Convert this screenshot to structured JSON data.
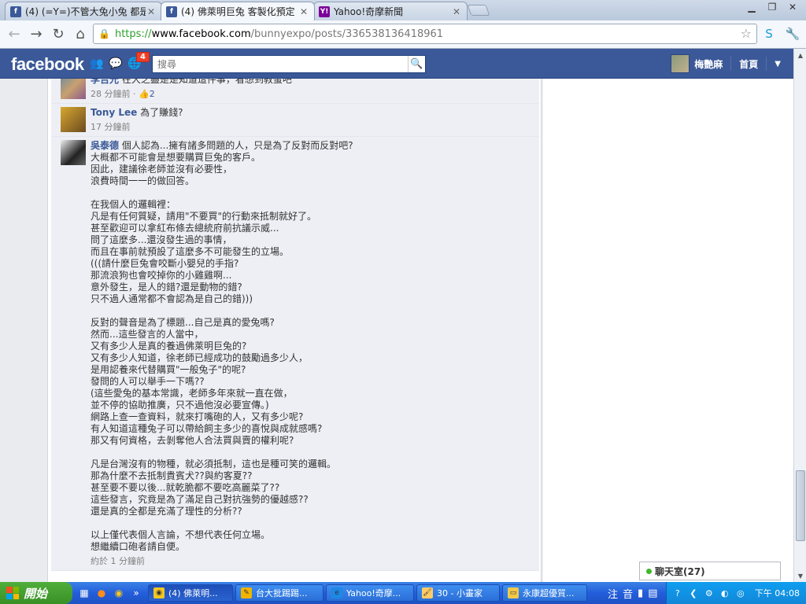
{
  "browser": {
    "tabs": [
      {
        "title": "(4) (=Y=)不管大兔小兔 都是",
        "active": false
      },
      {
        "title": "(4) 佛萊明巨兔 客製化預定",
        "active": true
      },
      {
        "title": "Yahoo!奇摩新聞",
        "active": false
      }
    ],
    "url": {
      "scheme": "https://",
      "host": "www.facebook.com",
      "path": "/bunnyexpo/posts/336538136418961"
    }
  },
  "facebook": {
    "logo": "facebook",
    "notification_count": "4",
    "search_placeholder": "搜尋",
    "user_name": "梅艷麻",
    "home_label": "首頁"
  },
  "comments": [
    {
      "name": "李吉光",
      "text_lines": [
        "在大之盡是是知道這件事，看想到教蛋吧"
      ],
      "time": "28 分鐘前",
      "likes": "2"
    },
    {
      "name": "Tony Lee",
      "text_lines": [
        "為了賺錢?"
      ],
      "time": "17 分鐘前",
      "likes": ""
    },
    {
      "name": "吳泰德",
      "text_lines": [
        "個人認為...擁有諸多問題的人，只是為了反對而反對吧?",
        "大概都不可能會是想要購買巨兔的客戶。",
        "因此，建議徐老師並沒有必要性，",
        "浪費時間一一的做回答。",
        "",
        "在我個人的邏輯裡：",
        "凡是有任何質疑，請用\"不要買\"的行動來抵制就好了。",
        "甚至歡迎可以拿紅布條去總統府前抗議示威...",
        "問了這麼多...還沒發生過的事情，",
        "而且在事前就預設了這麼多不可能發生的立場。",
        "(((請什麼巨兔會咬斷小嬰兒的手指?",
        "那流浪狗也會咬掉你的小雞雞啊...",
        "意外發生，是人的錯?還是動物的錯?",
        "只不過人通常都不會認為是自己的錯)))",
        "",
        "反對的聲音是為了標題...自己是真的愛兔嗎?",
        "然而...這些發言的人當中，",
        "又有多少人是真的養過佛萊明巨兔的?",
        "又有多少人知道，徐老師已經成功的鼓勵過多少人，",
        "是用認養來代替購買\"一般兔子\"的呢?",
        "發問的人可以舉手一下嗎??",
        "(這些愛兔的基本常識，老師多年來就一直在做，",
        "並不停的協助推廣，只不過他沒必要宣傳。)",
        "網路上查一查資料，就來打嘴砲的人，又有多少呢?",
        "有人知道這種兔子可以帶給飼主多少的喜悅與成就感嗎?",
        "那又有何資格，去剝奪他人合法買與賣的權利呢?",
        "",
        "凡是台灣沒有的物種，就必須抵制，這也是種可笑的邏輯。",
        "那為什麼不去抵制貴賓犬??與約客夏??",
        "甚至要不要以後...就乾脆都不要吃高麗菜了??",
        "這些發言，究竟是為了滿足自己對抗強勢的優越感??",
        "還是真的全都是充滿了理性的分析??",
        "",
        "以上僅代表個人言論，不想代表任何立場。",
        "想繼續口砲者請自便。"
      ],
      "time": "約於 1 分鐘前",
      "likes": ""
    }
  ],
  "chat": {
    "label": "聊天室(27)"
  },
  "taskbar": {
    "start_label": "開始",
    "items": [
      {
        "label": "(4) 佛萊明...",
        "active": true
      },
      {
        "label": "台大批踢踢...",
        "active": false
      },
      {
        "label": "Yahoo!奇摩...",
        "active": false
      },
      {
        "label": "30 - 小畫家",
        "active": false
      },
      {
        "label": "永康超優質...",
        "active": false
      }
    ],
    "ime": [
      "注",
      "音"
    ],
    "clock": "下午 04:08"
  },
  "colors": {
    "fb_blue": "#3b5998",
    "link": "#3b5998",
    "badge": "#f03d25"
  }
}
